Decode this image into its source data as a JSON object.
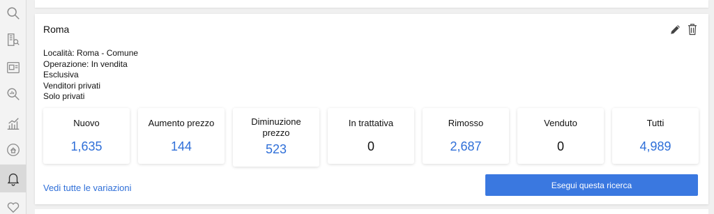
{
  "sidebar": {
    "items": [
      {
        "icon": "search-icon"
      },
      {
        "icon": "building-search-icon"
      },
      {
        "icon": "listing-card-icon"
      },
      {
        "icon": "analytics-search-icon"
      },
      {
        "icon": "bar-chart-icon"
      },
      {
        "icon": "home-radar-icon"
      },
      {
        "icon": "bell-icon",
        "active": true
      },
      {
        "icon": "heart-icon"
      }
    ]
  },
  "card": {
    "title": "Roma",
    "criteria": [
      "Località: Roma - Comune",
      "Operazione: In vendita",
      "Esclusiva",
      "Venditori privati",
      "Solo privati"
    ],
    "stats": [
      {
        "label": "Nuovo",
        "value": "1,635",
        "color": "#2f6fd8"
      },
      {
        "label": "Aumento prezzo",
        "value": "144",
        "color": "#2f6fd8"
      },
      {
        "label": "Diminuzione prezzo",
        "value": "523",
        "color": "#2f6fd8"
      },
      {
        "label": "In trattativa",
        "value": "0",
        "color": "#111111"
      },
      {
        "label": "Rimosso",
        "value": "2,687",
        "color": "#2f6fd8"
      },
      {
        "label": "Venduto",
        "value": "0",
        "color": "#111111"
      },
      {
        "label": "Tutti",
        "value": "4,989",
        "color": "#2f6fd8"
      }
    ],
    "see_all_link": "Vedi tutte le variazioni",
    "run_search_button": "Esegui questa ricerca"
  },
  "colors": {
    "accent": "#3a78e0",
    "link": "#2f6fd8"
  }
}
